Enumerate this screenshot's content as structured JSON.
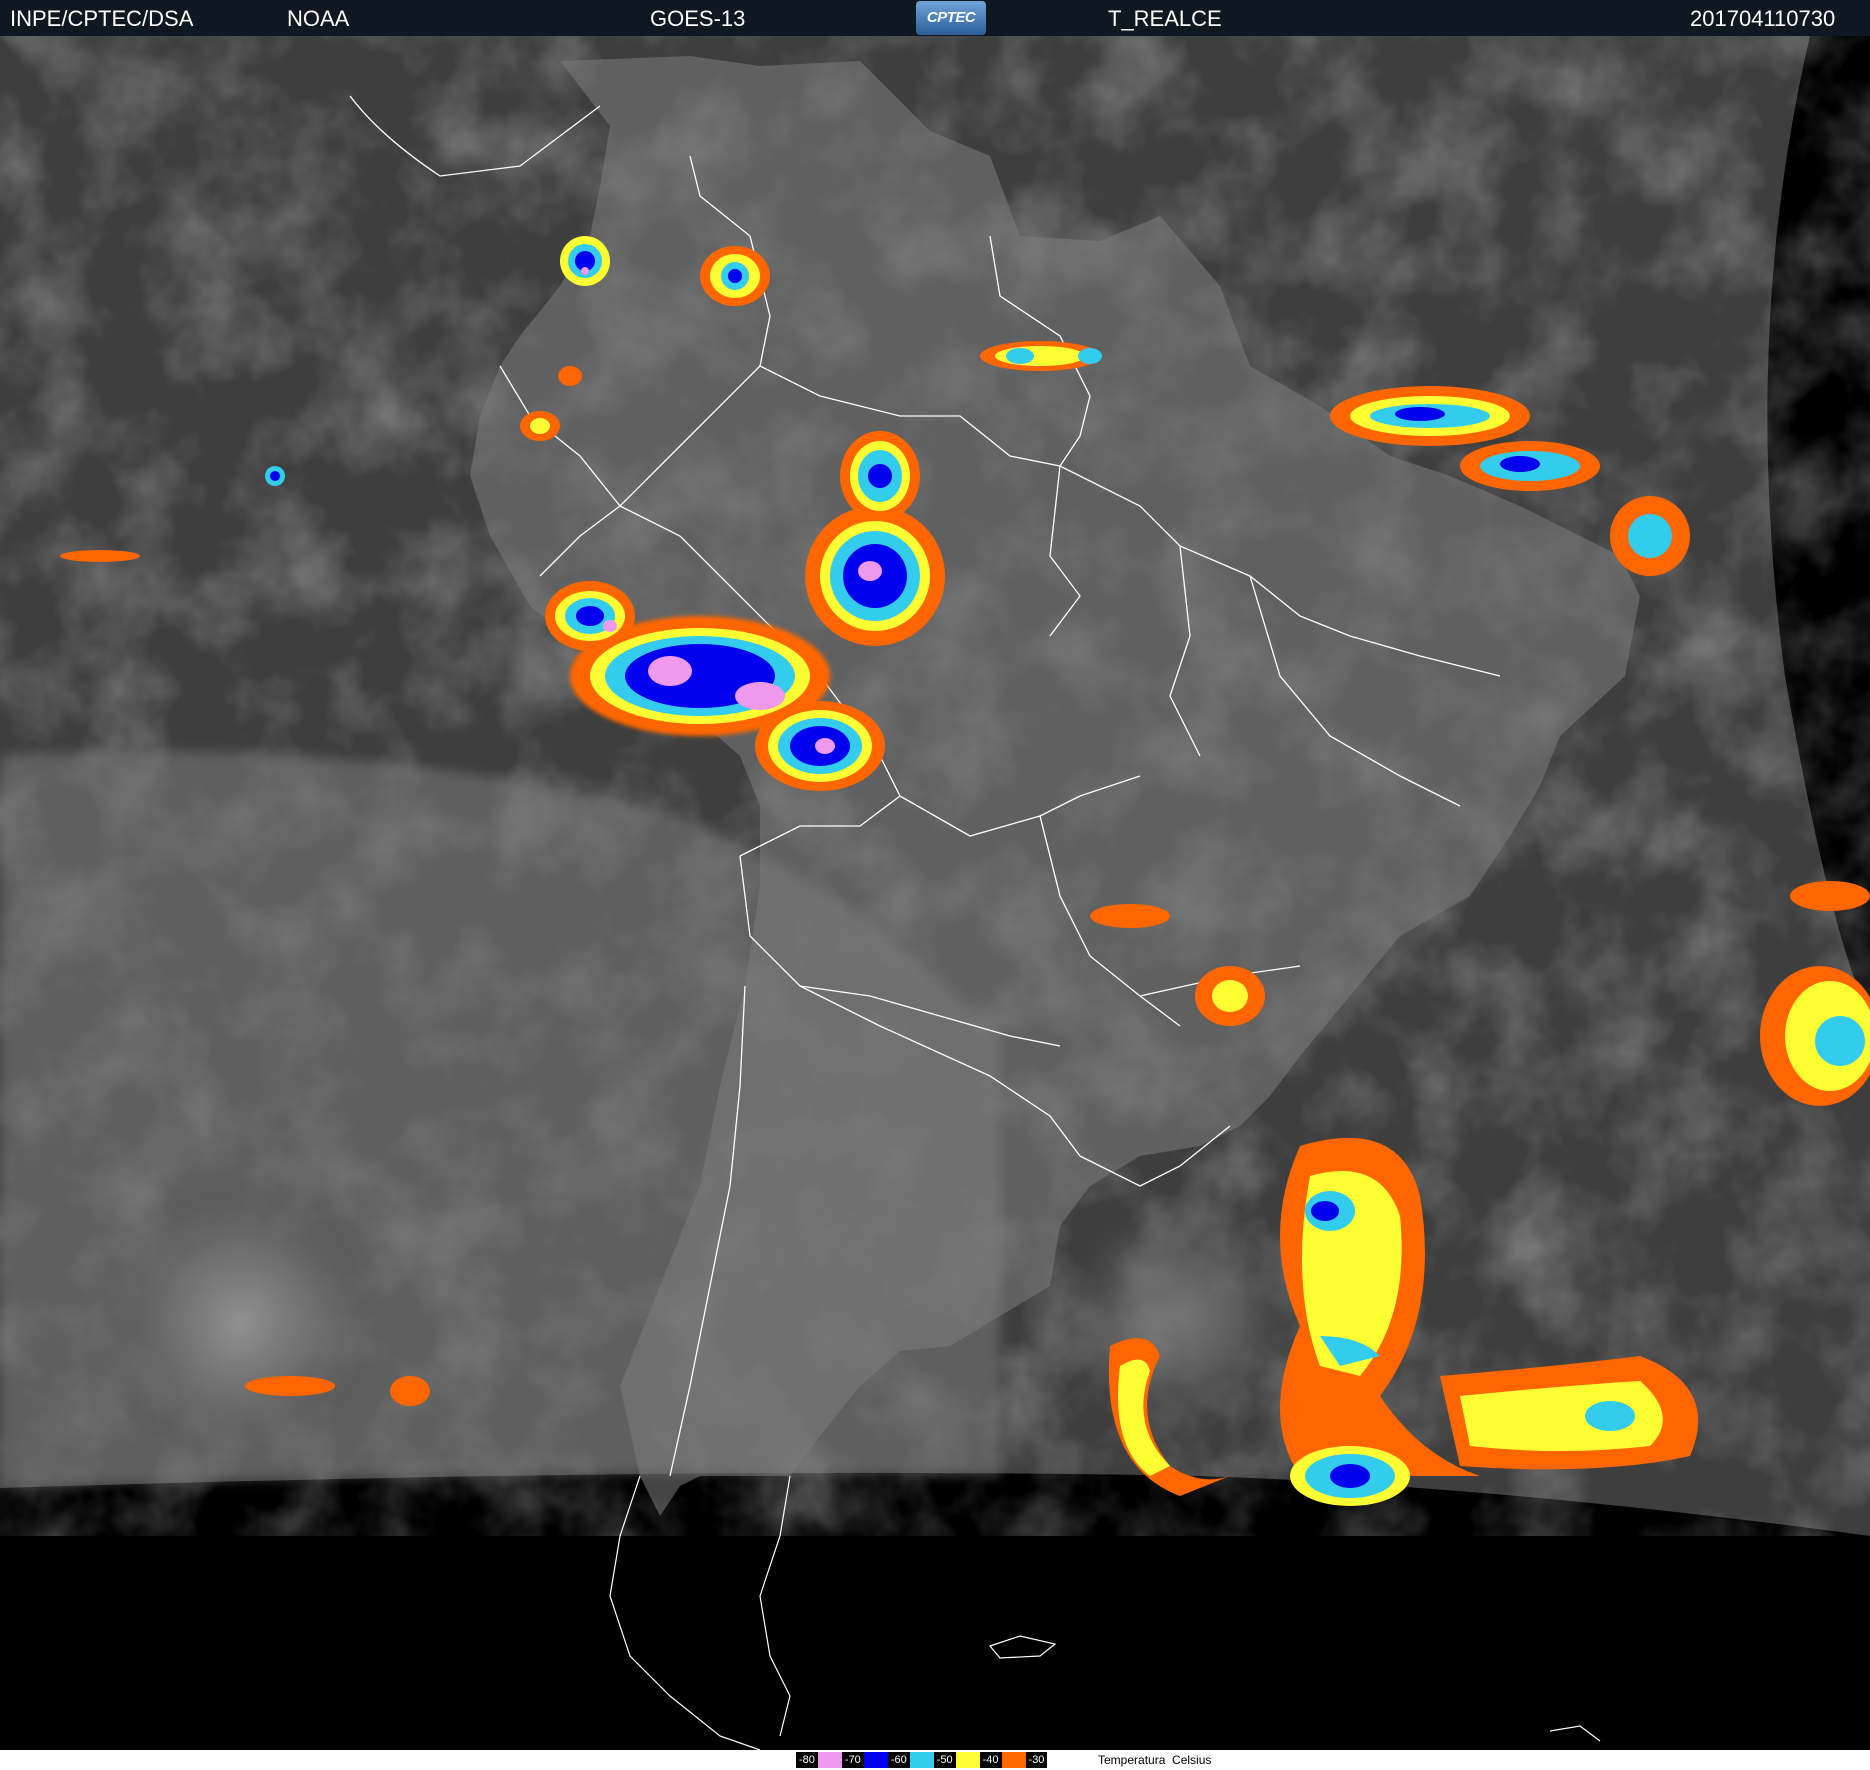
{
  "header": {
    "org": "INPE/CPTEC/DSA",
    "agency": "NOAA",
    "satellite": "GOES-13",
    "logo_text": "CPTEC",
    "product": "T_REALCE",
    "timestamp": "201704110730"
  },
  "legend": {
    "title": "Temperatura",
    "unit": "Celsius",
    "items": [
      {
        "label": "-80",
        "color": "#ee99ee"
      },
      {
        "label": "-70",
        "color": "#0000ee"
      },
      {
        "label": "-60",
        "color": "#33ccee"
      },
      {
        "label": "-50",
        "color": "#ffff33"
      },
      {
        "label": "-40",
        "color": "#ff6600"
      },
      {
        "label": "-30",
        "color": ""
      }
    ]
  },
  "map": {
    "background_cloud_color": "#6a6a6a",
    "ocean_color": "#3a3a3a",
    "space_color": "#000000",
    "border_color": "#ffffff"
  }
}
